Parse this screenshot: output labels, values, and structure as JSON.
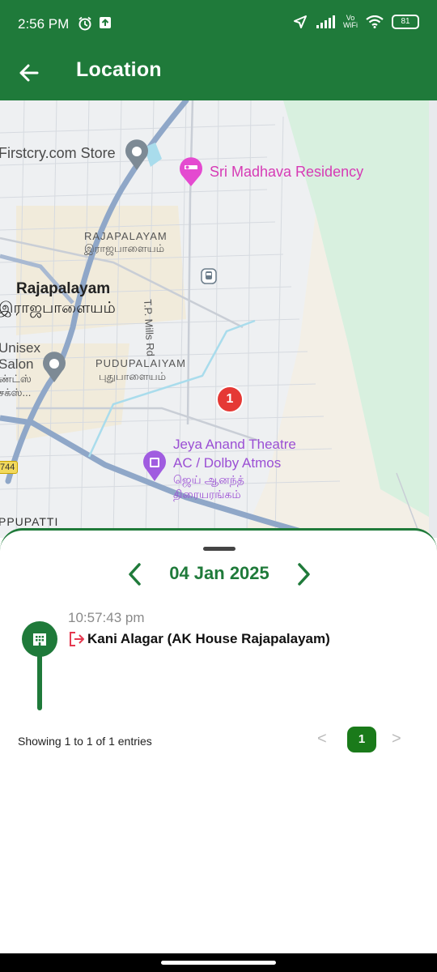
{
  "status_bar": {
    "time": "2:56 PM",
    "vo": "Vo",
    "wifi_label": "WiFi",
    "battery": "81",
    "icons": [
      "alarm-icon",
      "upload-icon",
      "location-arrow-icon",
      "signal-icon",
      "wifi-icon",
      "battery-icon"
    ]
  },
  "app_bar": {
    "title": "Location",
    "back_icon": "arrow-left-icon"
  },
  "map": {
    "labels": {
      "store": "Firstcry.com Store",
      "residency": "Sri Madhava Residency",
      "area1_en": "RAJAPALAYAM",
      "area1_ta": "இராஜபாளையம்",
      "town_en": "Rajapalayam",
      "town_ta": "இராஜபாளையம்",
      "road": "T.P. Mills Rd",
      "unisex": "Unisex",
      "salon": "Salon",
      "salon_ta1": "ண்ட்ஸ்",
      "salon_ta2": "சக்ஸ்...",
      "area2_en": "PUDUPALAIYAM",
      "area2_ta": "புதுபாளையம்",
      "theatre1": "Jeya Anand Theatre",
      "theatre2": "AC / Dolby Atmos",
      "theatre_ta1": "ஜெய் ஆனந்த்",
      "theatre_ta2": "திரையரங்கம்",
      "road_number": "744",
      "bottom_area": "PPUPATTI"
    },
    "marker_number": "1",
    "colors": {
      "water": "#a9dcec",
      "park": "#d8f0df",
      "sand": "#f3efe6",
      "road": "#8fa7c8"
    }
  },
  "sheet": {
    "date": "04 Jan 2025",
    "entries": [
      {
        "time": "10:57:43 pm",
        "name": "Kani Alagar (AK House Rajapalayam)"
      }
    ],
    "entries_text": "Showing 1 to 1 of 1 entries",
    "pagination": {
      "prev": "<",
      "current": "1",
      "next": ">"
    }
  },
  "colors": {
    "primary": "#1f7a3a",
    "accent_red": "#e53935"
  }
}
